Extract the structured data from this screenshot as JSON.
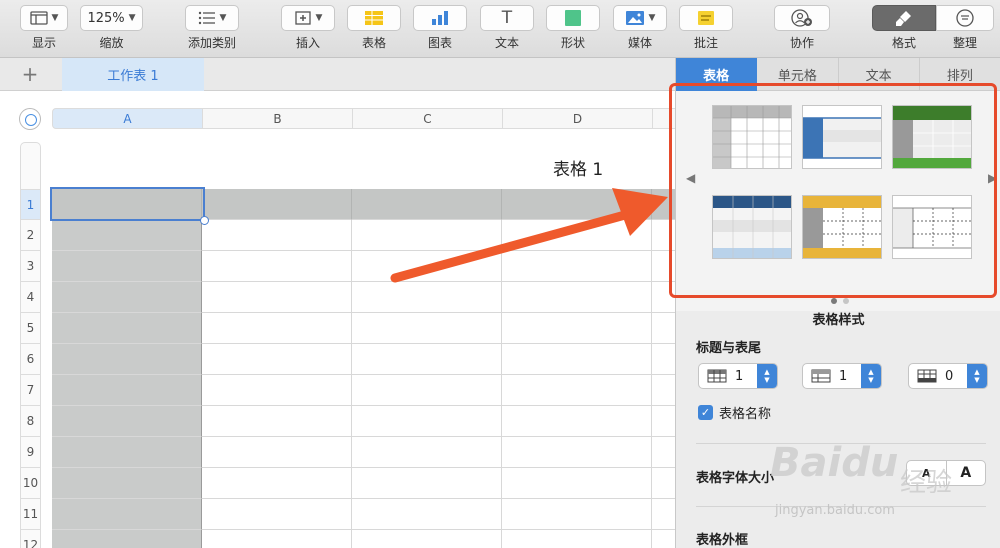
{
  "toolbar": {
    "view": {
      "label": "显示",
      "icon": "sidebar-icon"
    },
    "zoom": {
      "label": "缩放",
      "value": "125%"
    },
    "category": {
      "label": "添加类别",
      "icon": "list-icon"
    },
    "insert": {
      "label": "插入",
      "icon": "insert-icon"
    },
    "table": {
      "label": "表格",
      "icon": "table-icon"
    },
    "chart": {
      "label": "图表",
      "icon": "bar-chart-icon"
    },
    "text": {
      "label": "文本",
      "icon": "text-icon",
      "glyph": "T"
    },
    "shape": {
      "label": "形状",
      "icon": "shape-icon"
    },
    "media": {
      "label": "媒体",
      "icon": "image-icon"
    },
    "comment": {
      "label": "批注",
      "icon": "comment-icon"
    },
    "collaborate": {
      "label": "协作",
      "icon": "person-add-icon"
    },
    "format": {
      "label": "格式",
      "icon": "paintbrush-icon"
    },
    "organize": {
      "label": "整理",
      "icon": "organize-icon"
    }
  },
  "sheets": {
    "add": "+",
    "tabs": [
      {
        "label": "工作表 1"
      }
    ]
  },
  "spreadsheet": {
    "columns": [
      "A",
      "B",
      "C",
      "D"
    ],
    "rows": [
      "1",
      "2",
      "3",
      "4",
      "5",
      "6",
      "7",
      "8",
      "9",
      "10",
      "11",
      "12"
    ],
    "table_title": "表格 1"
  },
  "panel": {
    "tabs": [
      {
        "label": "表格"
      },
      {
        "label": "单元格"
      },
      {
        "label": "文本"
      },
      {
        "label": "排列"
      }
    ],
    "styles_label": "表格样式",
    "headers_title": "标题与表尾",
    "header_rows": "1",
    "header_cols": "1",
    "footer_rows": "0",
    "table_name_label": "表格名称",
    "font_size_title": "表格字体大小",
    "font_small": "A",
    "font_large": "A",
    "border_title": "表格外框"
  },
  "colors": {
    "accent": "#3f85d8",
    "annotation": "#e64a2b",
    "header_fill": "#c4c6c5"
  },
  "watermark": {
    "brand": "Baidu",
    "cn": "经验",
    "url": "jingyan.baidu.com"
  }
}
